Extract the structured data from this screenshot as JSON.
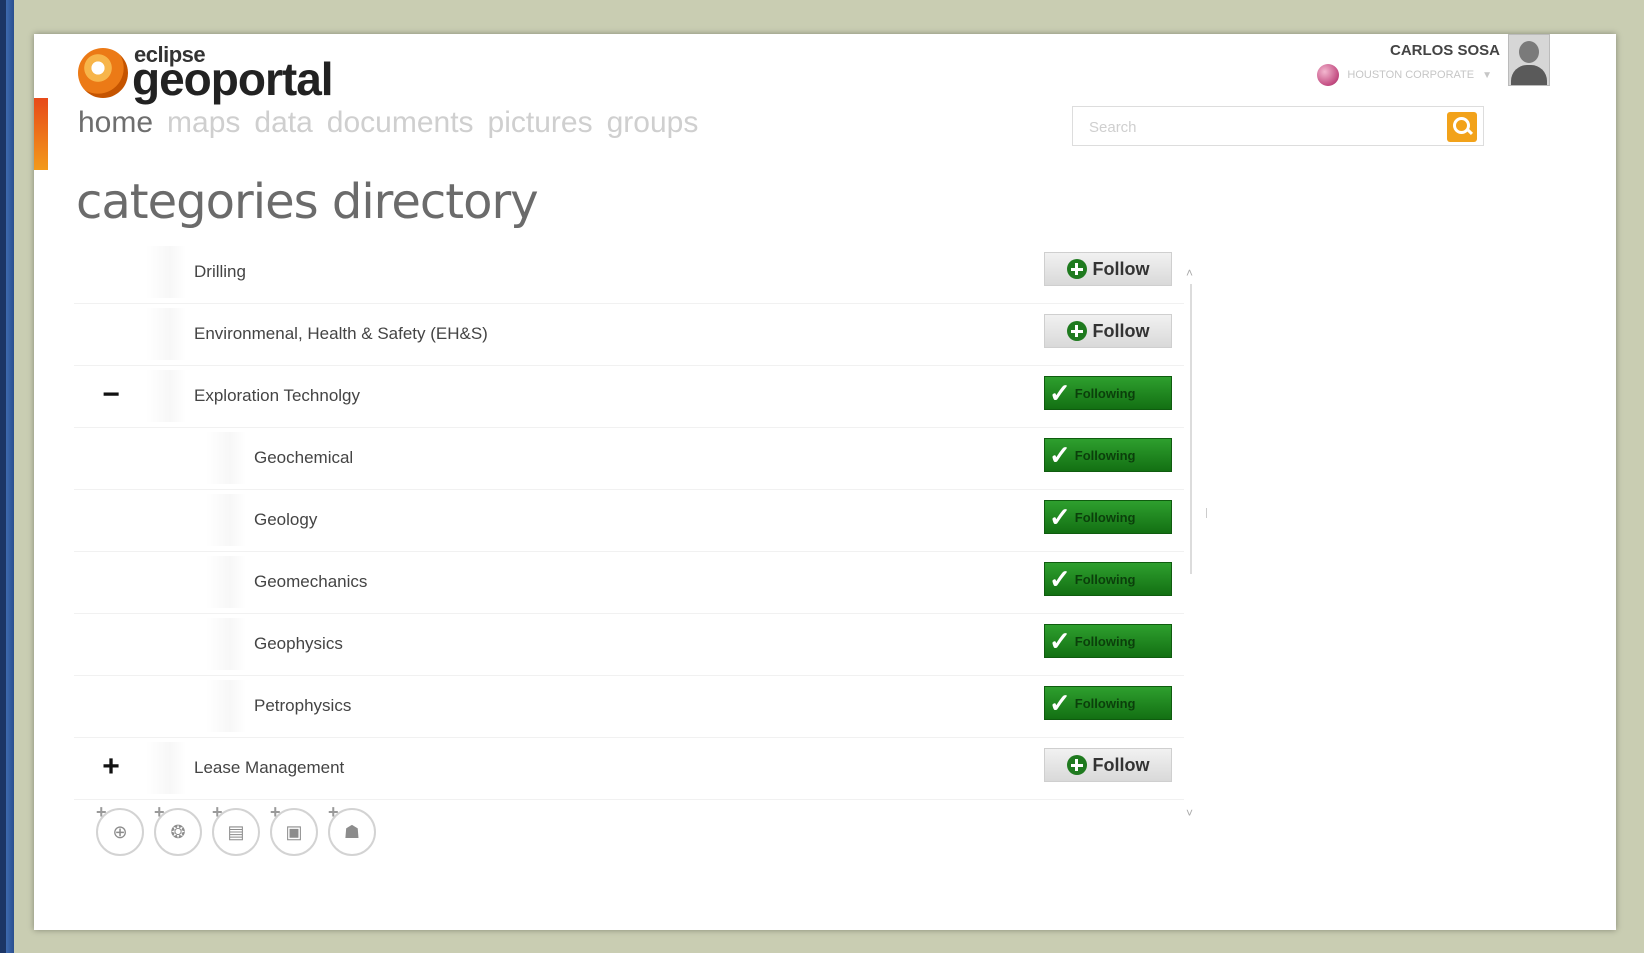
{
  "app": {
    "logo_small": "eclipse",
    "logo_big": "geoportal"
  },
  "nav": {
    "items": [
      {
        "label": "home",
        "active": true
      },
      {
        "label": "maps",
        "active": false
      },
      {
        "label": "data",
        "active": false
      },
      {
        "label": "documents",
        "active": false
      },
      {
        "label": "pictures",
        "active": false
      },
      {
        "label": "groups",
        "active": false
      }
    ]
  },
  "user": {
    "name": "CARLOS SOSA",
    "org": "HOUSTON CORPORATE",
    "caret": "▼"
  },
  "search": {
    "placeholder": "Search",
    "button_icon": "search-icon"
  },
  "page": {
    "title": "categories directory"
  },
  "categories": [
    {
      "label": "Drilling",
      "level": 0,
      "toggle": "",
      "status": "follow",
      "button_label": "Follow"
    },
    {
      "label": "Environmenal, Health & Safety (EH&S)",
      "level": 0,
      "toggle": "",
      "status": "follow",
      "button_label": "Follow"
    },
    {
      "label": "Exploration Technolgy",
      "level": 0,
      "toggle": "−",
      "status": "following",
      "button_label": "Following"
    },
    {
      "label": "Geochemical",
      "level": 1,
      "toggle": "",
      "status": "following",
      "button_label": "Following"
    },
    {
      "label": "Geology",
      "level": 1,
      "toggle": "",
      "status": "following",
      "button_label": "Following"
    },
    {
      "label": "Geomechanics",
      "level": 1,
      "toggle": "",
      "status": "following",
      "button_label": "Following"
    },
    {
      "label": "Geophysics",
      "level": 1,
      "toggle": "",
      "status": "following",
      "button_label": "Following"
    },
    {
      "label": "Petrophysics",
      "level": 1,
      "toggle": "",
      "status": "following",
      "button_label": "Following"
    },
    {
      "label": "Lease Management",
      "level": 0,
      "toggle": "+",
      "status": "follow",
      "button_label": "Follow"
    }
  ],
  "scroll": {
    "up": "˄",
    "down": "˅"
  },
  "actions": [
    {
      "name": "add-map-icon",
      "glyph": "⊕"
    },
    {
      "name": "add-data-icon",
      "glyph": "❂"
    },
    {
      "name": "add-document-icon",
      "glyph": "▤"
    },
    {
      "name": "add-picture-icon",
      "glyph": "▣"
    },
    {
      "name": "add-group-icon",
      "glyph": "☗"
    }
  ],
  "colors": {
    "accent": "#f2a21a",
    "following_green": "#1f8a1f",
    "nav_active": "#6e6e6e",
    "nav_inactive": "#cfcfcf"
  }
}
